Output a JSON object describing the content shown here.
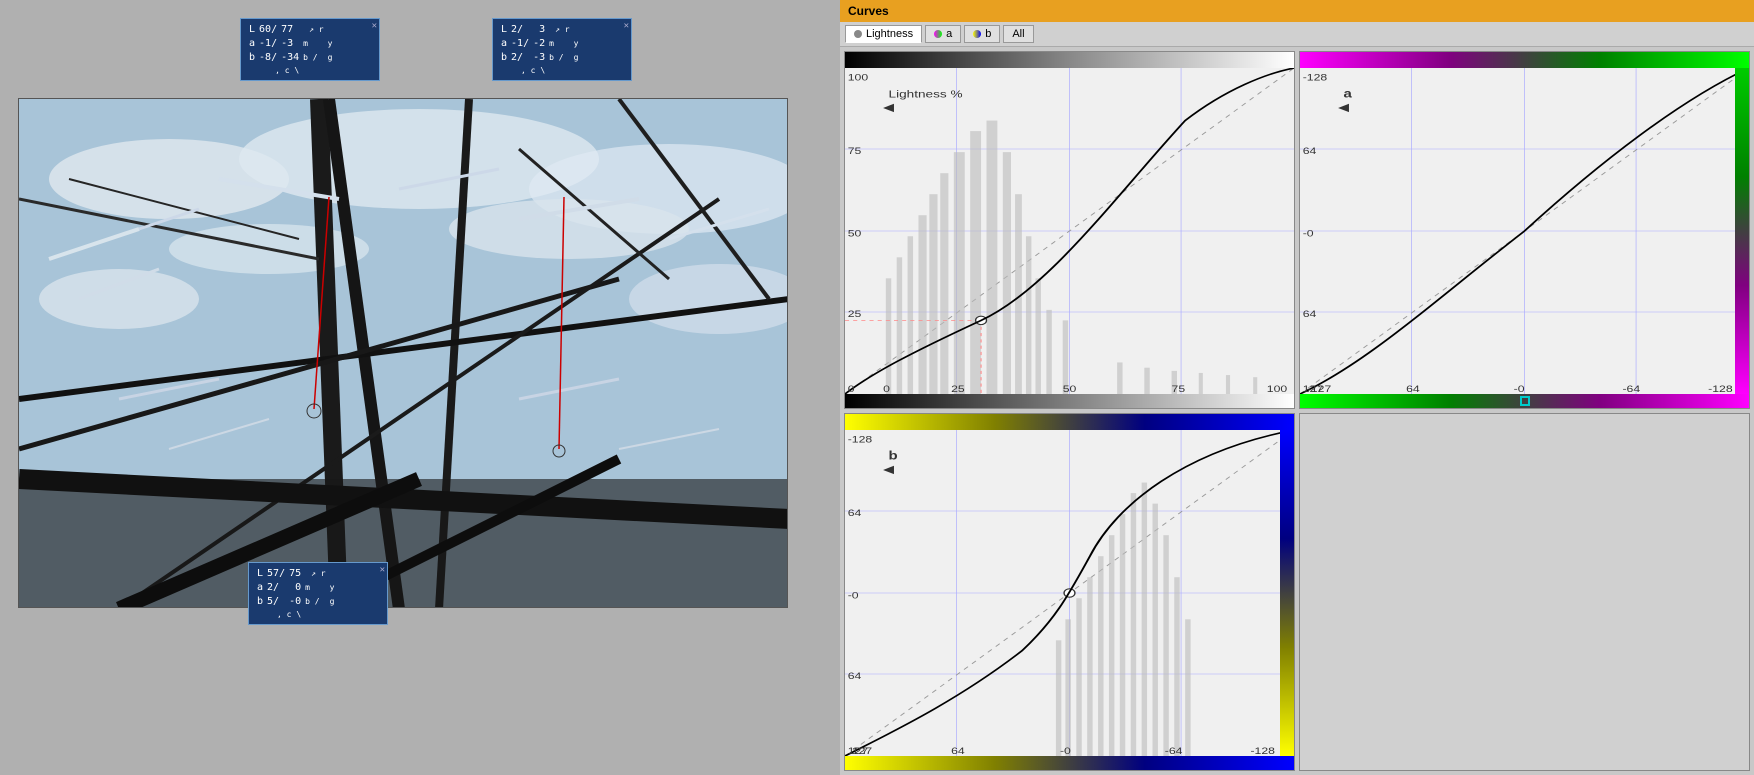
{
  "app": {
    "title": "Curves"
  },
  "left_panel": {
    "info_box_1": {
      "L": "60/",
      "L2": "77",
      "a": "-1/",
      "a2": "-3",
      "b": "-8/",
      "b2": "-34",
      "r": "r",
      "m": "m",
      "y": "y",
      "b_label": "b",
      "slash": "/",
      "c": "c",
      "g": "g"
    },
    "info_box_2": {
      "L": "2/",
      "L2": "3",
      "a": "-1/",
      "a2": "-2",
      "b": "2/",
      "b2": "-3",
      "r": "r",
      "m": "m",
      "y": "y",
      "b_label": "b",
      "slash": "/",
      "c": "c",
      "g": "g"
    },
    "info_box_3": {
      "L": "57/",
      "L2": "75",
      "a": "2/",
      "a2": "0",
      "b": "5/",
      "b2": "-0",
      "r": "r",
      "m": "m",
      "y": "y",
      "b_label": "b",
      "slash": "/",
      "c": "c",
      "g": "g"
    }
  },
  "right_panel": {
    "title": "Curves",
    "tabs": [
      {
        "label": "Lightness",
        "active": true,
        "dot": "lightness"
      },
      {
        "label": "a",
        "active": false,
        "dot": "a"
      },
      {
        "label": "b",
        "active": false,
        "dot": "b"
      },
      {
        "label": "All",
        "active": false,
        "dot": "none"
      }
    ],
    "chart_lightness": {
      "label": "Lightness %",
      "y_labels": [
        "100",
        "75",
        "50",
        "25",
        "0"
      ],
      "x_labels": [
        "0",
        "25",
        "50",
        "75",
        "100"
      ]
    },
    "chart_a": {
      "label": "a",
      "y_labels": [
        "-128",
        "64",
        "-0",
        "64",
        "127"
      ],
      "x_labels": [
        "-127",
        "64",
        "-0",
        "-64",
        "-128"
      ]
    },
    "chart_b": {
      "label": "b",
      "y_labels": [
        "-128",
        "64",
        "-0",
        "64",
        "127"
      ],
      "x_labels": [
        "127",
        "64",
        "-0",
        "-64",
        "-128"
      ]
    }
  }
}
